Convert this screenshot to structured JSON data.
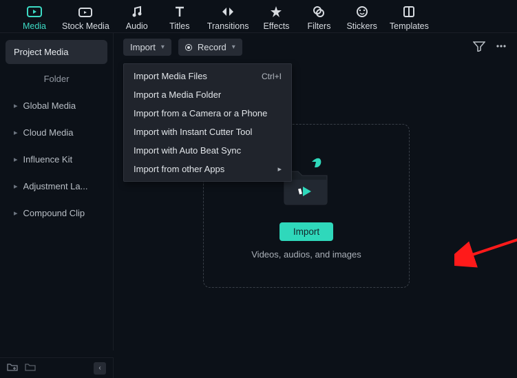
{
  "topnav": [
    {
      "label": "Media",
      "active": true
    },
    {
      "label": "Stock Media"
    },
    {
      "label": "Audio"
    },
    {
      "label": "Titles"
    },
    {
      "label": "Transitions"
    },
    {
      "label": "Effects"
    },
    {
      "label": "Filters"
    },
    {
      "label": "Stickers"
    },
    {
      "label": "Templates"
    }
  ],
  "sidebar": {
    "project_media": "Project Media",
    "folder": "Folder",
    "items": [
      {
        "label": "Global Media"
      },
      {
        "label": "Cloud Media"
      },
      {
        "label": "Influence Kit"
      },
      {
        "label": "Adjustment La..."
      },
      {
        "label": "Compound Clip"
      }
    ]
  },
  "toolbar": {
    "import": "Import",
    "record": "Record"
  },
  "menu": [
    {
      "label": "Import Media Files",
      "shortcut": "Ctrl+I"
    },
    {
      "label": "Import a Media Folder"
    },
    {
      "label": "Import from a Camera or a Phone"
    },
    {
      "label": "Import with Instant Cutter Tool"
    },
    {
      "label": "Import with Auto Beat Sync"
    },
    {
      "label": "Import from other Apps",
      "submenu": true
    }
  ],
  "dropzone": {
    "import": "Import",
    "sub": "Videos, audios, and images"
  }
}
